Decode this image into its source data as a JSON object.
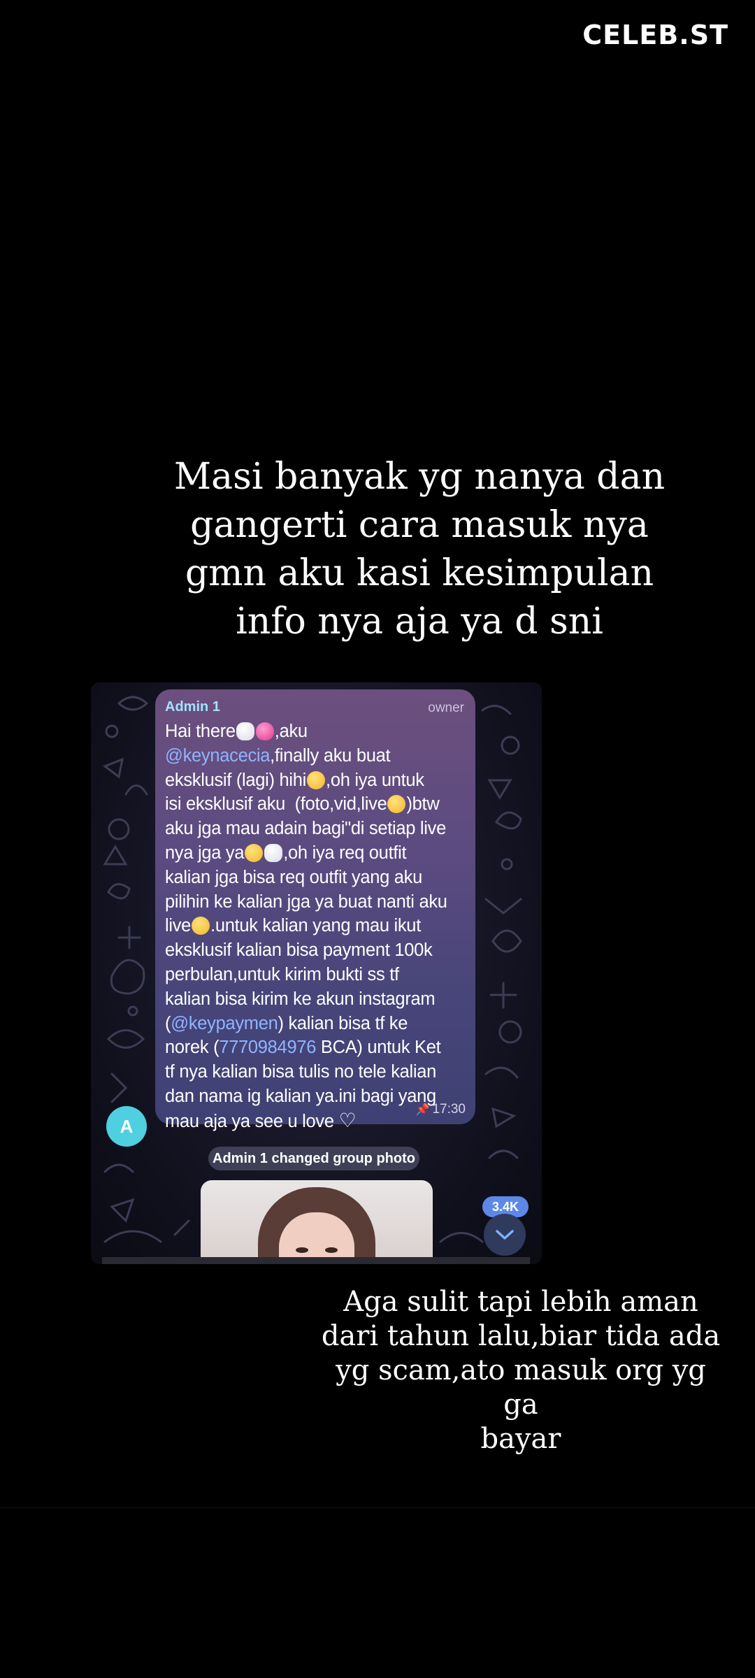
{
  "watermark": "CELEB.ST",
  "caption_top": "Masi banyak yg nanya dan\ngangerti cara masuk nya\ngmn aku kasi kesimpulan\ninfo nya aja ya d sni",
  "caption_bottom": "Aga sulit tapi lebih aman\ndari tahun lalu,biar tida ada\nyg scam,ato masuk org yg ga\nbayar",
  "chat": {
    "sender": "Admin 1",
    "role": "owner",
    "message": {
      "p1": "Hai there",
      "p2": ",aku\n",
      "mention1": "@keynacecia",
      "p3": ",finally aku buat\neksklusif (lagi) hihi",
      "p4": ",oh iya untuk\nisi eksklusif aku  (foto,vid,live",
      "p5": ")btw\naku jga mau adain bagi\"di setiap live\nnya jga ya",
      "p6": ",oh iya req outfit\nkalian jga bisa req outfit yang aku\npilihin ke kalian jga ya buat nanti aku\nlive",
      "p7": ".untuk kalian yang mau ikut\neksklusif kalian bisa payment 100k\nperbulan,untuk kirim bukti ss tf\nkalian bisa kirim ke akun instagram\n(",
      "mention2": "@keypaymen",
      "p8": ") kalian bisa tf ke\nnorek (",
      "account": "7770984976",
      "p9": " BCA) untuk Ket\ntf nya kalian bisa tulis no tele kalian\ndan nama ig kalian ya.ini bagi yang\nmau aja ya see u love "
    },
    "time": "17:30",
    "avatar_letter": "A",
    "service_message": "Admin 1 changed group photo",
    "unread_badge": "3.4K",
    "icons": {
      "pin": "pin-icon",
      "scroll": "chevron-down-icon",
      "heart": "white-heart-icon"
    }
  },
  "colors": {
    "background": "#000000",
    "bubble": "#5b4b80",
    "sender": "#9fe3ff",
    "mention": "#8fb4ff",
    "badge": "#5c89e8",
    "avatar": "#4fd0e0"
  }
}
